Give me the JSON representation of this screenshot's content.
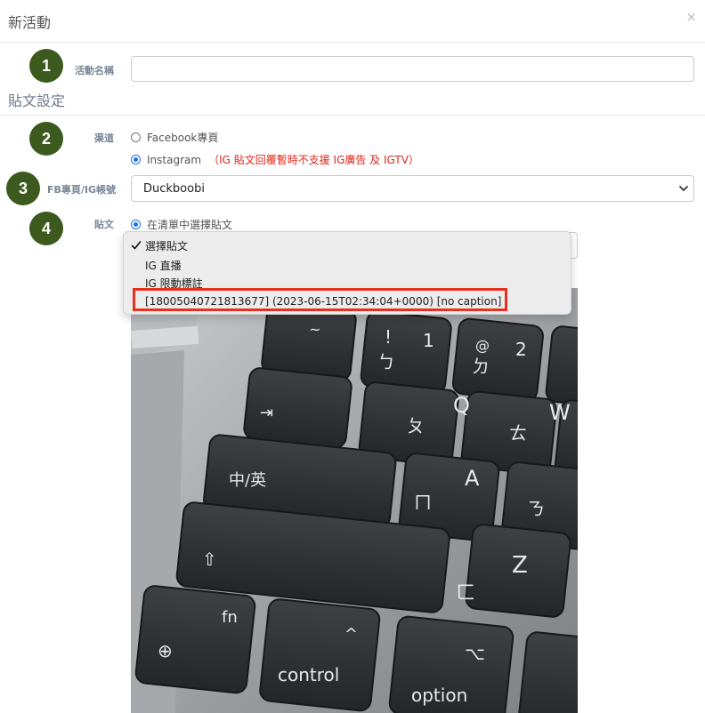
{
  "modal": {
    "title": "新活動",
    "close_label": "×"
  },
  "steps": [
    "1",
    "2",
    "3",
    "4"
  ],
  "fields": {
    "activity_name_label": "活動名稱",
    "activity_name_value": "",
    "section_title": "貼文設定",
    "channel_label": "渠道",
    "channel_options": [
      {
        "label": "Facebook專頁",
        "selected": false
      },
      {
        "label": "Instagram",
        "selected": true
      }
    ],
    "channel_warning": "（IG 貼文回覆暫時不支援 IG廣告 及 IGTV）",
    "account_label": "FB專頁/IG帳號",
    "account_value": "Duckboobi",
    "post_label": "貼文",
    "post_option": "在清單中選擇貼文"
  },
  "dropdown": {
    "options": [
      {
        "label": "選擇貼文",
        "checked": true
      },
      {
        "label": "IG 直播",
        "checked": false
      },
      {
        "label": "IG 限動標註",
        "checked": false
      },
      {
        "label": "[18005040721813677] (2023-06-15T02:34:04+0000) [no caption]",
        "checked": false
      }
    ]
  },
  "photo": {
    "keys": [
      "~",
      "!",
      "1",
      "@",
      "2",
      "⇥",
      "Q",
      "W",
      "中/英",
      "A",
      "Z",
      "fn",
      "control",
      "option",
      "ㄆ",
      "ㄅ",
      "ㄉ",
      "ㄊ",
      "ㄇ",
      "ㄈ",
      "ㄋ",
      "ㄌ",
      "⌥"
    ]
  },
  "colors": {
    "badge": "#3c5a1e",
    "highlight": "#e8301f",
    "radio_accent": "#1a73e8",
    "warning_text": "#e0261b"
  }
}
